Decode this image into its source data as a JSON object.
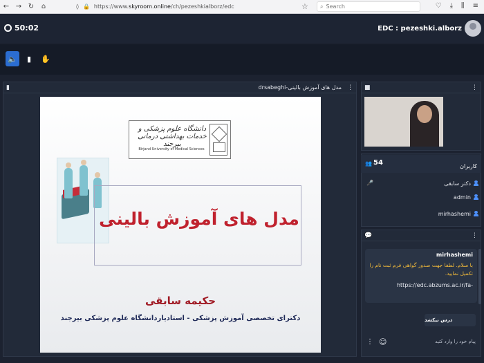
{
  "browser": {
    "back_icon": "←",
    "forward_icon": "→",
    "reload_icon": "↻",
    "home_icon": "⌂",
    "url_prefix": "https://www.",
    "url_host": "skyroom.online",
    "url_path": "/ch/pezeshkialborz/edc",
    "search_placeholder": "Search",
    "star_icon": "☆"
  },
  "header": {
    "timer": "50:02",
    "room_title": "EDC : pezeshki.alborz"
  },
  "toolbar": {
    "speaker_icon": "🔈",
    "doc_icon": "▮",
    "hand_icon": "✋"
  },
  "presentation": {
    "title": "drsabeghi-مدل های آموزش بالینی",
    "menu_icon": "⋮",
    "doc_icon": "▮"
  },
  "slide": {
    "logo_script": "دانشگاه علوم پزشکی و خدمات بهداشتی درمانی بیرجند",
    "logo_english": "Birjand University of Medical Sciences",
    "main_title": "مدل های آموزش بالینی",
    "author": "حکیمه سابقی",
    "affiliation": "دکترای تخصصی آموزش پزشکی - استادیاردانشگاه علوم پزشکی بیرجند"
  },
  "video_panel": {
    "camera_icon": "■",
    "menu_icon": "⋮"
  },
  "users": {
    "icon": "👥",
    "count": "54",
    "label": "کاربران",
    "list": [
      {
        "name": "دکتر سابقی"
      },
      {
        "name": "admin"
      },
      {
        "name": "mirhashemi"
      }
    ],
    "mic_icon": "🎤"
  },
  "chat": {
    "icon": "💬",
    "menu_icon": "⋮",
    "sender": "mirhashemi",
    "message": "با سلام. لطفا جهت صدور گواهی فرم ثبت نام را تکمیل نمایید.",
    "link": "https://edc.abzums.ac.ir/fa-",
    "message2": "درس نیکشد",
    "input_placeholder": "پیام خود را وارد کنید",
    "emoji_icon": "☺",
    "more_icon": "⋮"
  }
}
